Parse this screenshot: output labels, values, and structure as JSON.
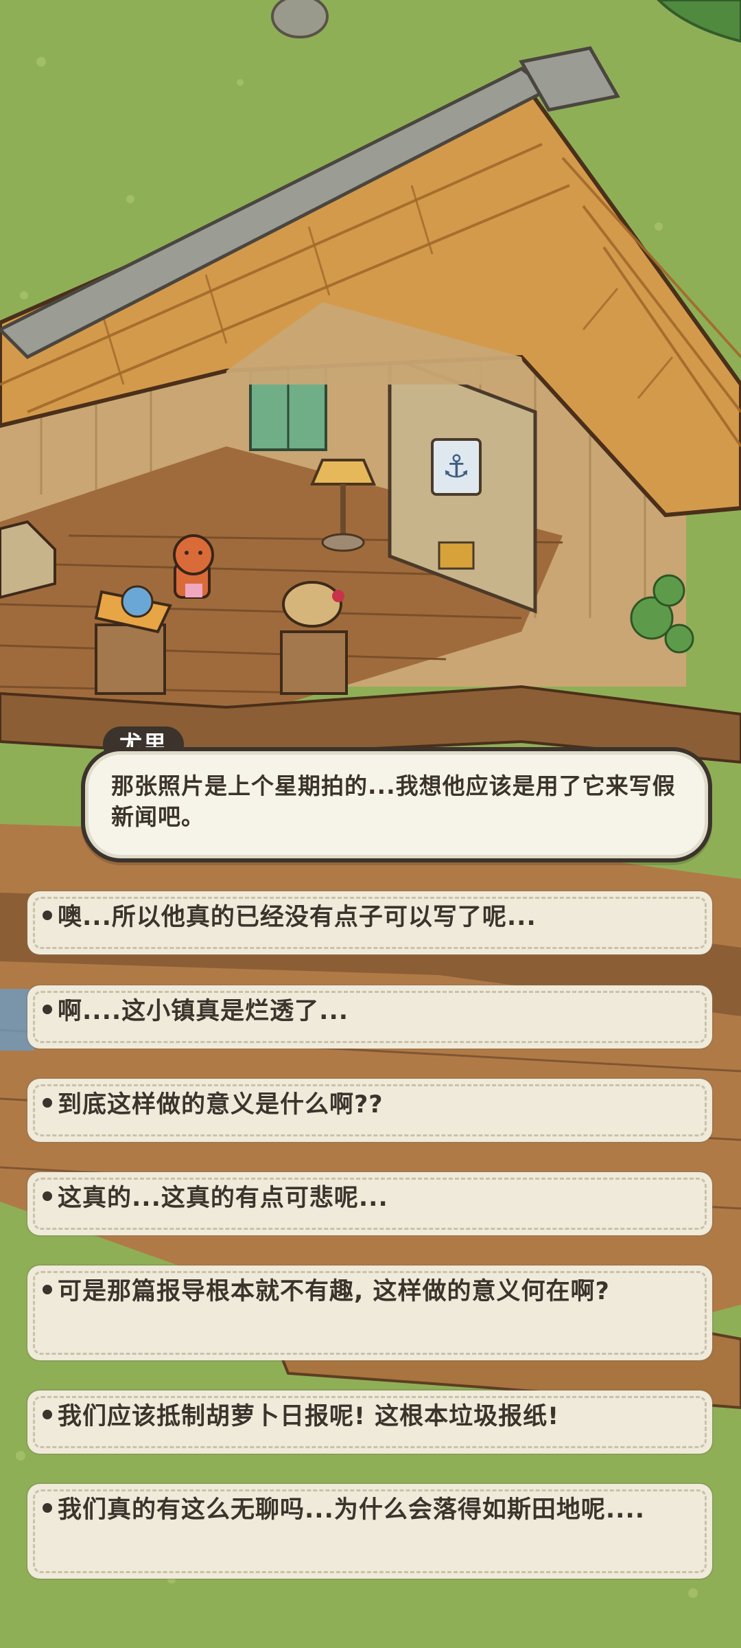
{
  "dialogue": {
    "speaker": "尤里",
    "text": "那张照片是上个星期拍的...我想他应该是用了它来写假新闻吧。"
  },
  "options": [
    {
      "text": "噢...所以他真的已经没有点子可以写了呢..."
    },
    {
      "text": "啊....这小镇真是烂透了..."
    },
    {
      "text": "到底这样做的意义是什么啊??"
    },
    {
      "text": "这真的...这真的有点可悲呢..."
    },
    {
      "text": "可是那篇报导根本就不有趣, 这样做的意义何在啊?"
    },
    {
      "text": "我们应该抵制胡萝卜日报呢! 这根本垃圾报纸!"
    },
    {
      "text": "我们真的有这么无聊吗...为什么会落得如斯田地呢...."
    }
  ],
  "icons": {
    "sign_icon": "anchor-icon"
  },
  "colors": {
    "grass": "#8faf57",
    "roof": "#cf9a4c",
    "wood_floor": "#9c6a3e",
    "wall": "#c9a674",
    "text_dark": "#3b332c",
    "option_bg": "#efead9"
  }
}
